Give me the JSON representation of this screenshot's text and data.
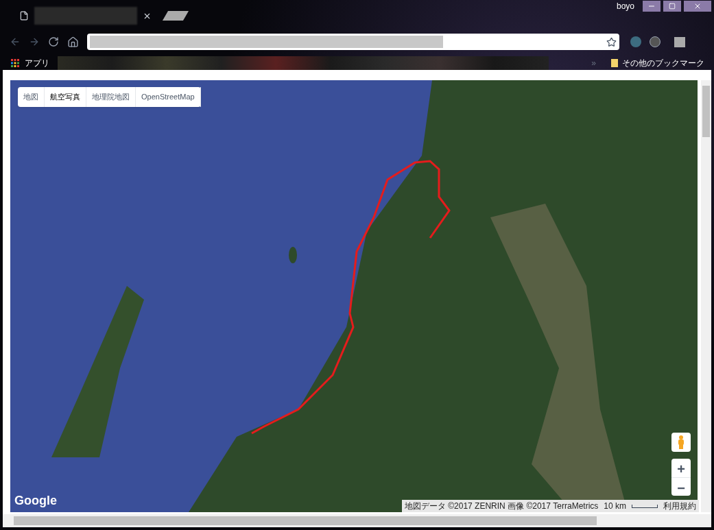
{
  "window": {
    "user": "boyo"
  },
  "bookmarks_bar": {
    "apps": "アプリ",
    "overflow": "»",
    "other": "その他のブックマーク"
  },
  "map": {
    "type_buttons": [
      {
        "label": "地図",
        "selected": false
      },
      {
        "label": "航空写真",
        "selected": true
      },
      {
        "label": "地理院地図",
        "selected": false
      },
      {
        "label": "OpenStreetMap",
        "selected": false
      }
    ],
    "logo": "Google",
    "attribution": "地図データ ©2017 ZENRIN 画像 ©2017 TerraMetrics",
    "scale": "10 km",
    "terms": "利用規約",
    "zoom_in": "+",
    "zoom_out": "−"
  }
}
